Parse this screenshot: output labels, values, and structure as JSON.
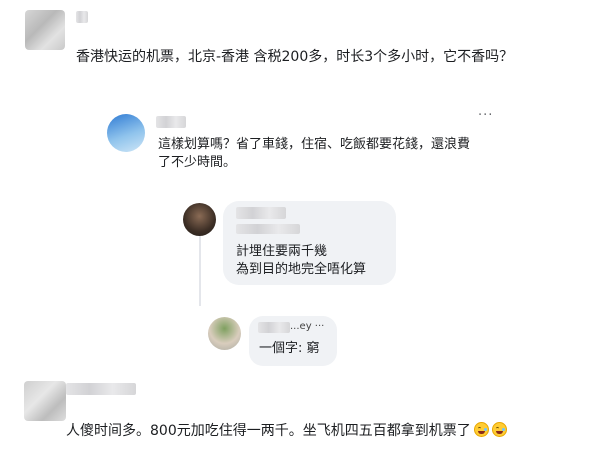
{
  "comments": [
    {
      "text": "香港快运的机票，北京-香港 含税200多，时长3个多小时，它不香吗？",
      "replies": [
        {
          "line1": "這樣划算嗎？省了車錢，住宿、吃飯都要花錢，還浪費",
          "line2": "了不少時間。",
          "more": "···",
          "replies": [
            {
              "line1": "計埋住要兩千幾",
              "line2": "為到目的地完全唔化算"
            },
            {
              "name_fragment": "...ey ···",
              "text": "一個字: 窮"
            }
          ]
        }
      ]
    },
    {
      "text": "人傻时间多。800元加吃住得一两千。坐飞机四五百都拿到机票了",
      "emoji": [
        "grinning-sweat-emoji",
        "grinning-sweat-emoji"
      ]
    }
  ]
}
